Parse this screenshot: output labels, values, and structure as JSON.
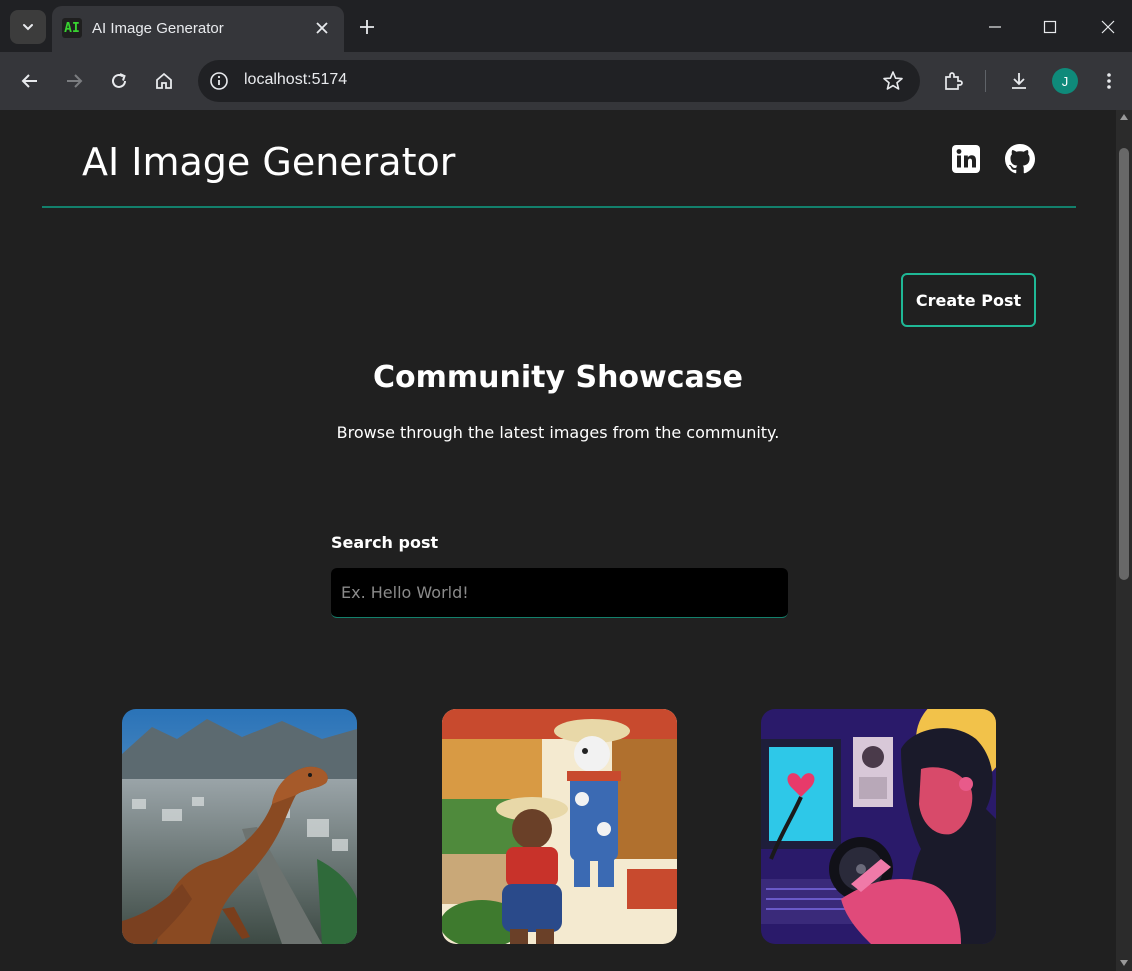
{
  "browser": {
    "tab": {
      "favicon_text": "AI",
      "title": "AI Image Generator"
    },
    "url": "localhost:5174",
    "profile_initial": "J"
  },
  "header": {
    "title": "AI Image Generator",
    "social": [
      "linkedin-icon",
      "github-icon"
    ]
  },
  "actions": {
    "create_post": "Create Post"
  },
  "showcase": {
    "title": "Community Showcase",
    "subtitle": "Browse through the latest images from the community."
  },
  "search": {
    "label": "Search post",
    "placeholder": "Ex. Hello World!",
    "value": ""
  },
  "gallery": {
    "cards": [
      "dinosaur-city-image",
      "bears-market-image",
      "dj-turntable-image"
    ]
  },
  "colors": {
    "accent": "#1fb896",
    "header_line": "#13806c",
    "page_bg": "#202020",
    "input_bg": "#000000"
  }
}
